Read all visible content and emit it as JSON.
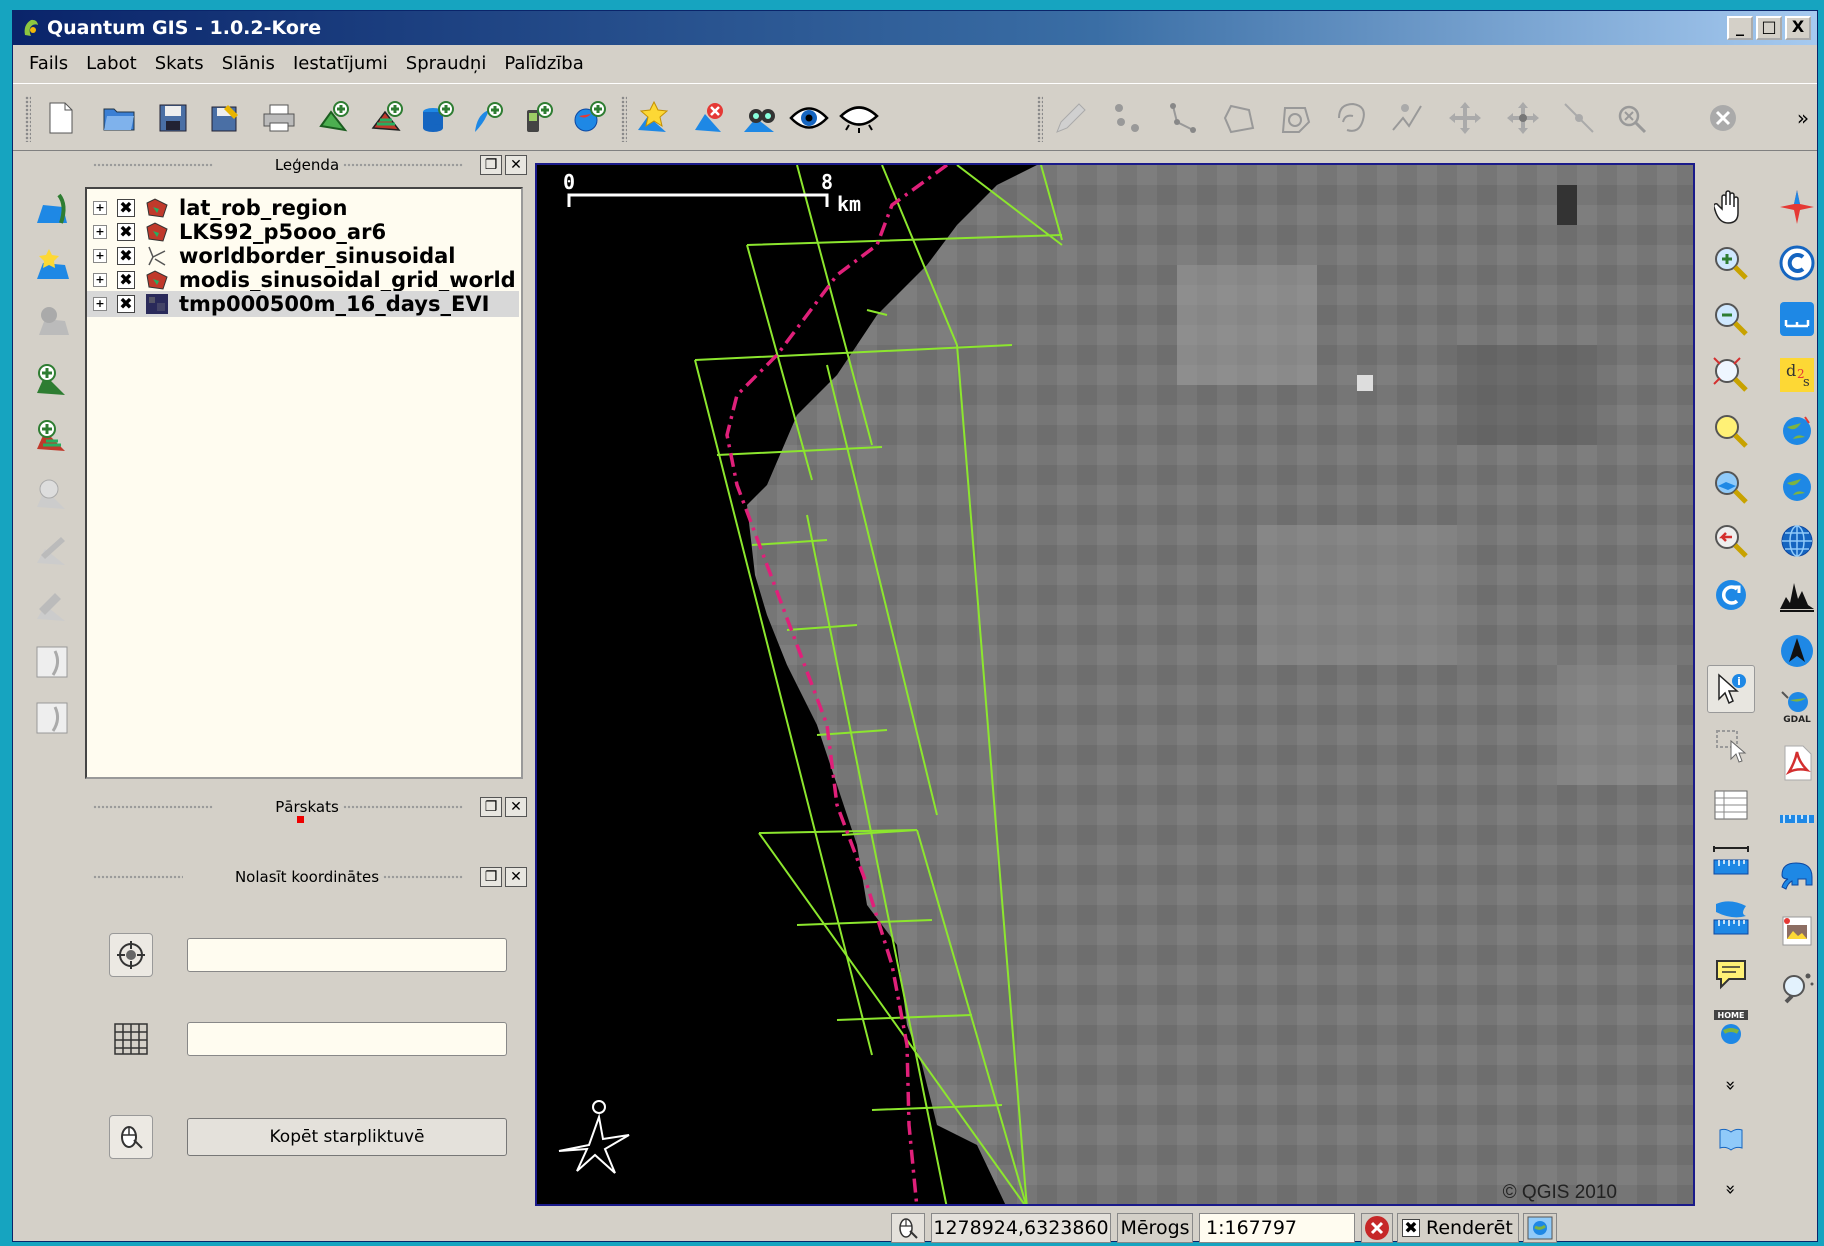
{
  "window": {
    "title": "Quantum GIS - 1.0.2-Kore",
    "controls": [
      "_",
      "□",
      "X"
    ]
  },
  "menu": [
    "Fails",
    "Labot",
    "Skats",
    "Slānis",
    "Iestatījumi",
    "Spraudņi",
    "Palīdzība"
  ],
  "toolbar": {
    "overflow": "»"
  },
  "legend_panel": {
    "title": "Leģenda",
    "layers": [
      {
        "name": "lat_rob_region",
        "checked": "✖",
        "icon": "polygon-layer-icon"
      },
      {
        "name": "LKS92_p5ooo_ar6",
        "checked": "✖",
        "icon": "polygon-layer-icon"
      },
      {
        "name": "worldborder_sinusoidal",
        "checked": "✖",
        "icon": "line-layer-icon"
      },
      {
        "name": "modis_sinusoidal_grid_world",
        "checked": "✖",
        "icon": "polygon-layer-icon"
      },
      {
        "name": "tmp000500m_16_days_EVI",
        "checked": "✖",
        "icon": "raster-layer-icon"
      }
    ]
  },
  "overview_panel": {
    "title": "Pārskats"
  },
  "coords_panel": {
    "title": "Nolasīt koordinātes",
    "copy_button": "Kopēt starpliktuvē"
  },
  "map": {
    "scalebar": {
      "start": "0",
      "end": "8",
      "unit": "km"
    },
    "copyright": "© QGIS 2010"
  },
  "right_toolbar": {
    "more1": "»",
    "more2": "»"
  },
  "status": {
    "coordinates": "1278924,6323860",
    "scale_label": "Mērogs",
    "scale_value": "1:167797",
    "render_label": "Renderēt",
    "render_checked": "✖"
  },
  "colors": {
    "grid_lines": "#8ce62e",
    "border_line": "#e0207a",
    "title_bar": "#0a246a"
  }
}
